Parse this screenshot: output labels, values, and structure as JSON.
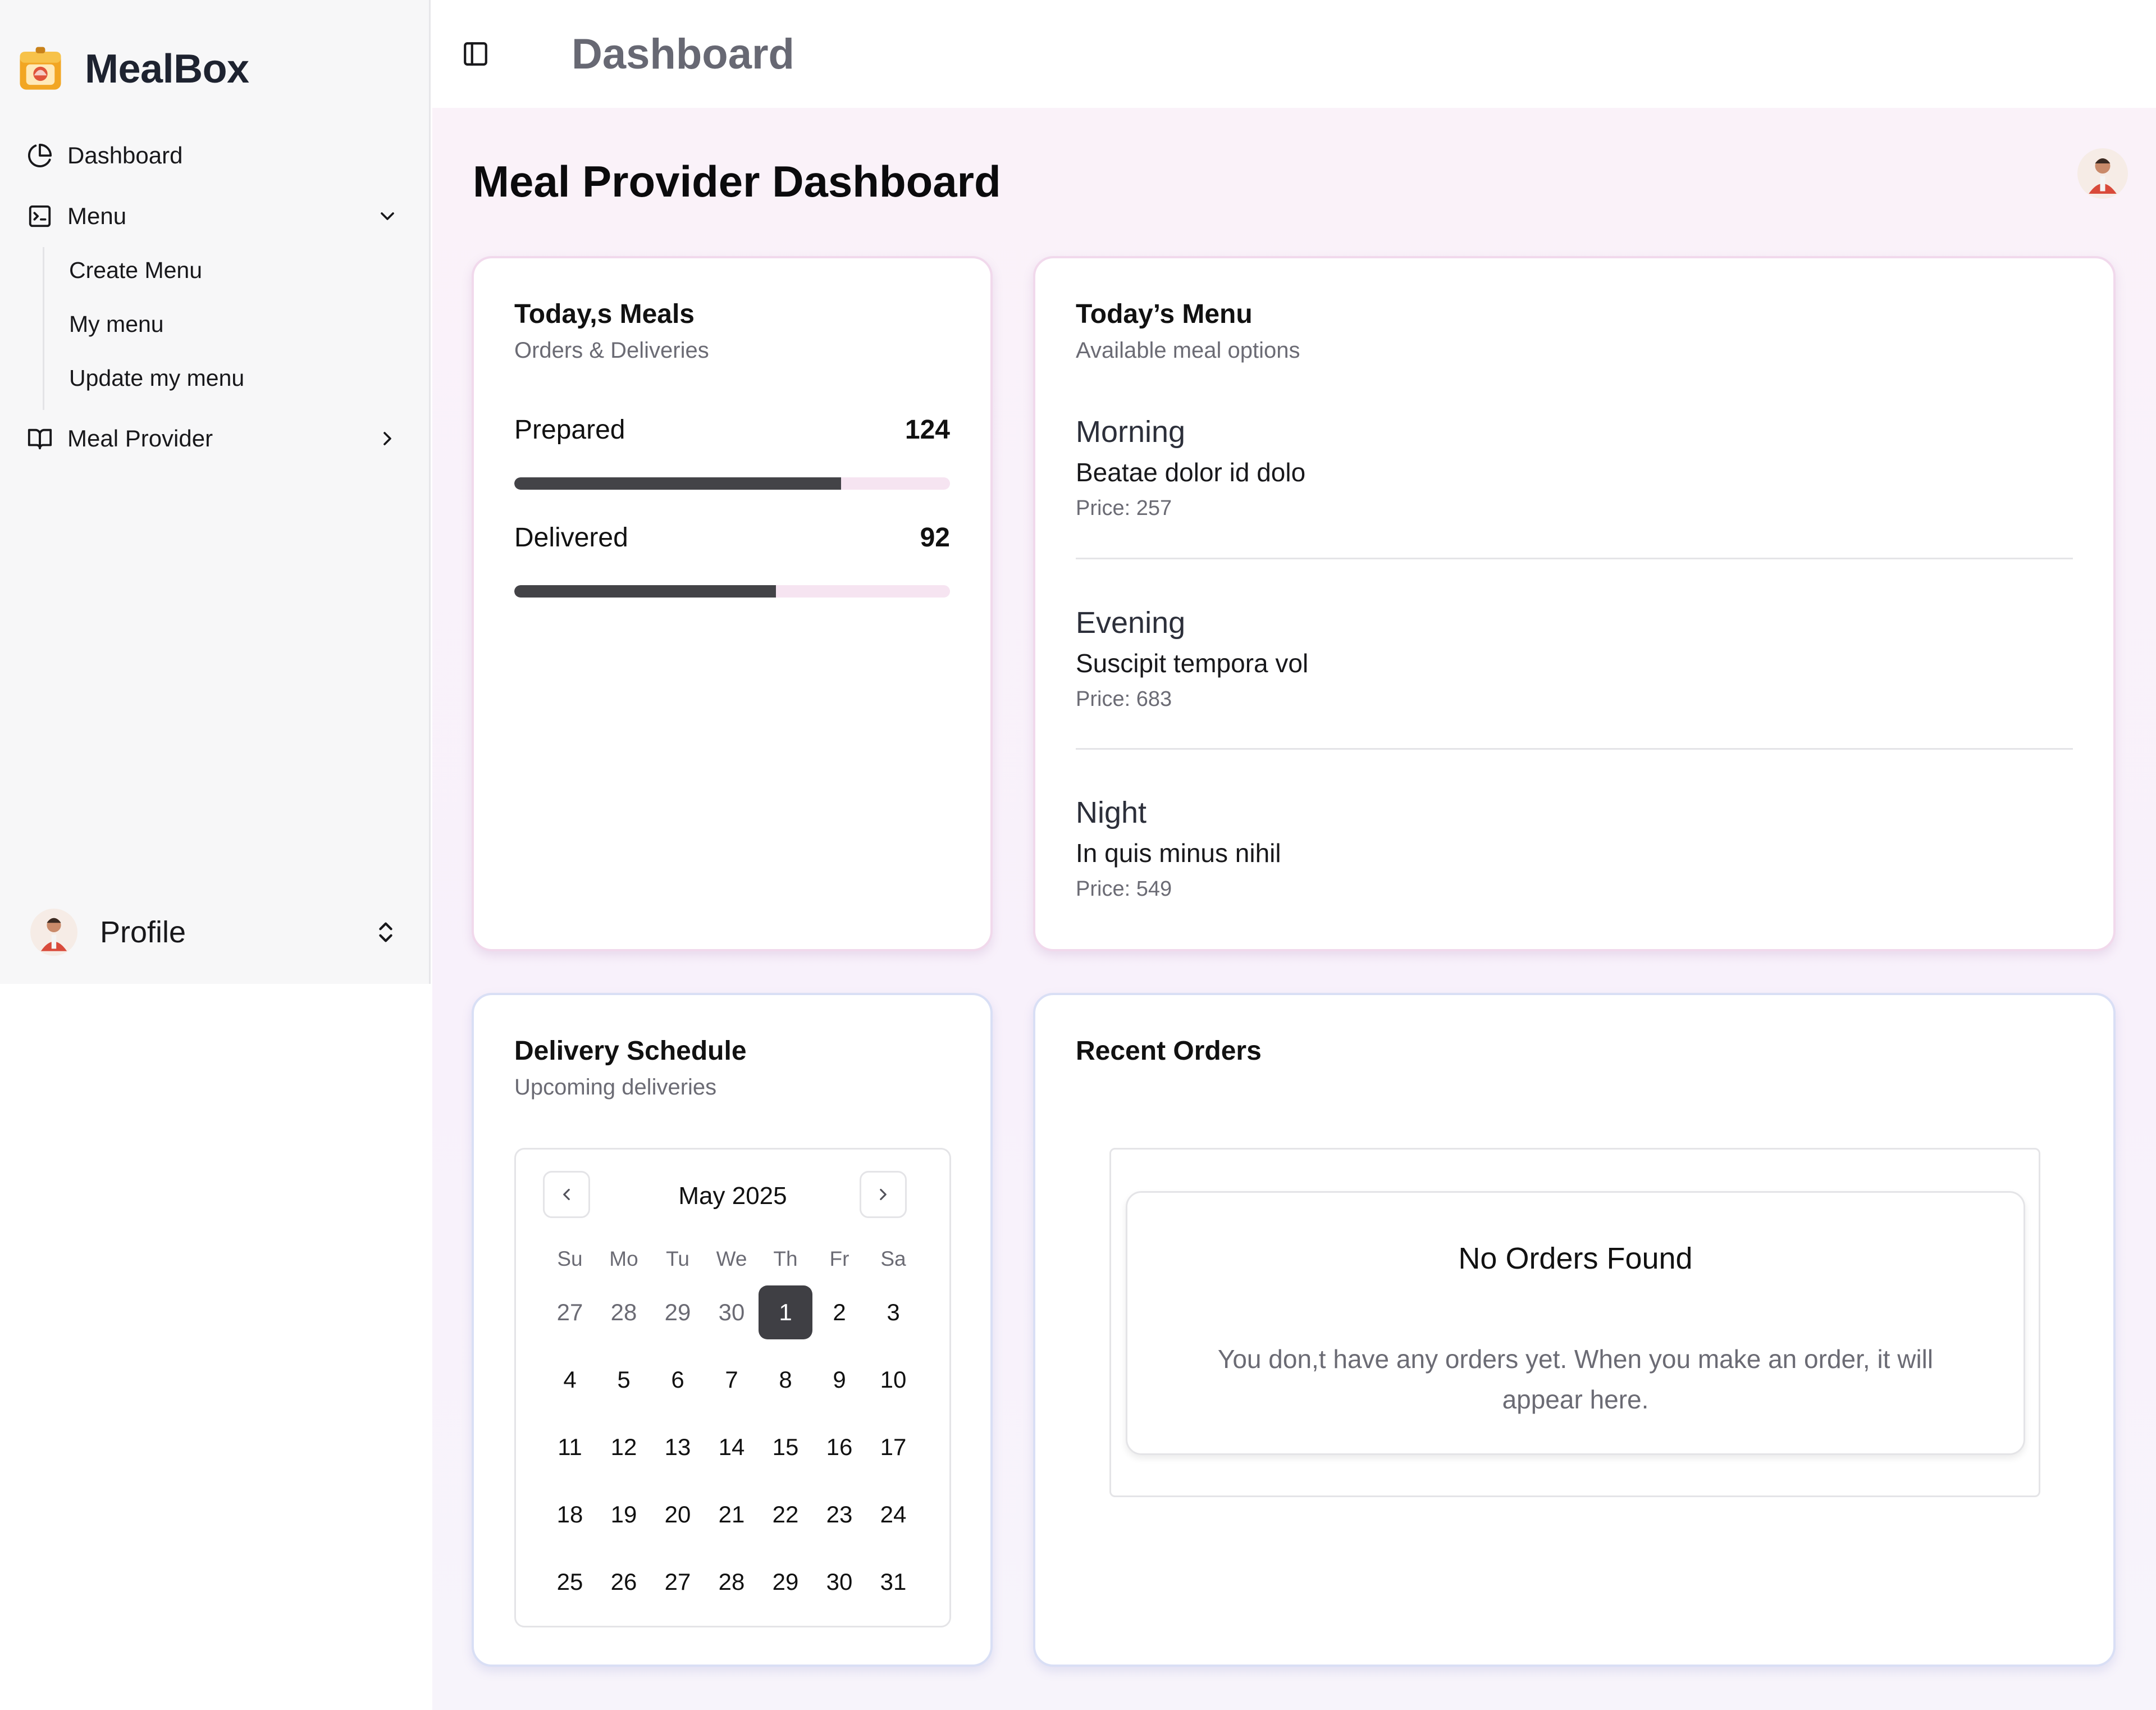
{
  "brand": {
    "name": "MealBox"
  },
  "sidebar": {
    "items": [
      {
        "label": "Dashboard",
        "icon": "pie-chart-icon"
      },
      {
        "label": "Menu",
        "icon": "terminal-square-icon",
        "expanded": true,
        "children": [
          "Create Menu",
          "My menu",
          "Update my menu"
        ]
      },
      {
        "label": "Meal Provider",
        "icon": "book-open-icon",
        "expanded": false
      }
    ],
    "profile": {
      "label": "Profile"
    }
  },
  "header": {
    "title": "Dashboard"
  },
  "main": {
    "title": "Meal Provider Dashboard",
    "meals_card": {
      "title": "Today,s Meals",
      "subtitle": "Orders & Deliveries",
      "stats": [
        {
          "label": "Prepared",
          "value": "124",
          "progress": 0.75
        },
        {
          "label": "Delivered",
          "value": "92",
          "progress": 0.6
        }
      ]
    },
    "menu_card": {
      "title": "Today’s Menu",
      "subtitle": "Available meal options",
      "meals": [
        {
          "slot": "Morning",
          "name": "Beatae dolor id dolo",
          "price": "Price: 257"
        },
        {
          "slot": "Evening",
          "name": "Suscipit tempora vol",
          "price": "Price: 683"
        },
        {
          "slot": "Night",
          "name": "In quis minus nihil",
          "price": "Price: 549"
        }
      ]
    },
    "schedule_card": {
      "title": "Delivery Schedule",
      "subtitle": "Upcoming deliveries",
      "calendar": {
        "month": "May 2025",
        "weekdays": [
          "Su",
          "Mo",
          "Tu",
          "We",
          "Th",
          "Fr",
          "Sa"
        ],
        "weeks": [
          [
            "27",
            "28",
            "29",
            "30",
            "1",
            "2",
            "3"
          ],
          [
            "4",
            "5",
            "6",
            "7",
            "8",
            "9",
            "10"
          ],
          [
            "11",
            "12",
            "13",
            "14",
            "15",
            "16",
            "17"
          ],
          [
            "18",
            "19",
            "20",
            "21",
            "22",
            "23",
            "24"
          ],
          [
            "25",
            "26",
            "27",
            "28",
            "29",
            "30",
            "31"
          ]
        ],
        "selected": "1"
      }
    },
    "orders_card": {
      "title": "Recent Orders",
      "empty_title": "No Orders Found",
      "empty_text": "You don,t have any orders yet. When you make an order, it will appear here."
    }
  },
  "colors": {
    "accent": "#434347",
    "progress_track": "#f6e4f1",
    "card_border_pink": "#f1d9ec",
    "card_border_blue": "#d9dff5"
  }
}
